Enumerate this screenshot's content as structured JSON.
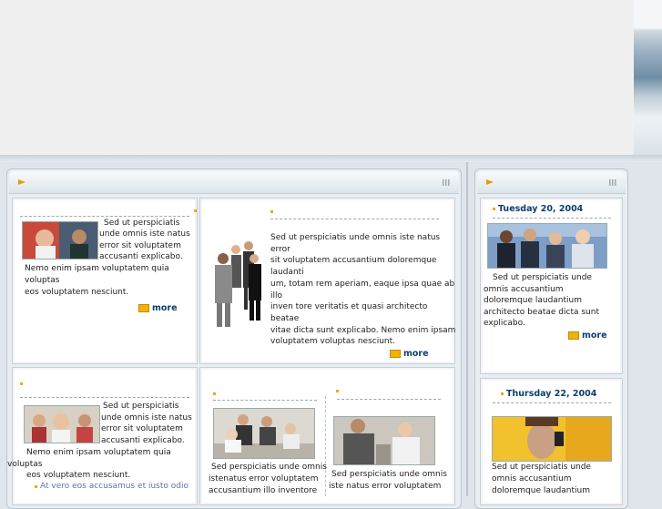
{
  "colors": {
    "accent": "#f0a800",
    "link_dark": "#0e3e6e",
    "link_light": "#5577aa",
    "panel_bg": "#e9eef2"
  },
  "icons": [
    "arrow-right-icon",
    "grip-icon",
    "bullet-icon",
    "more-icon"
  ],
  "articles": {
    "a1": {
      "lines": [
        "Sed ut perspiciatis",
        "unde  omnis iste natus",
        "error sit  voluptatem",
        "accusanti  explicabo.",
        "Nemo enim ipsam voluptatem quia",
        "voluptas",
        "eos voluptatem nesciunt."
      ],
      "more": "more"
    },
    "a2": {
      "lines": [
        "Sed ut perspiciatis unde omnis iste natus",
        "error",
        "sit voluptatem accusantium doloremque",
        "laudanti",
        "um, totam rem aperiam, eaque ipsa quae ab",
        "illo",
        "inven tore veritatis et quasi architecto",
        "beatae",
        "vitae dicta sunt explicabo. Nemo enim ipsam",
        "voluptatem voluptas nesciunt."
      ],
      "more": "more"
    },
    "a3": {
      "lines": [
        "Sed ut perspiciatis",
        "unde  omnis iste natus",
        "error sit  voluptatem",
        "accusanti  explicabo.",
        "Nemo enim ipsam voluptatem quia",
        "voluptas",
        "eos voluptatem nesciunt."
      ],
      "link": "At vero eos accusamus et iusto odio"
    },
    "a4": {
      "lines": [
        "Sed perspiciatis unde omnis",
        "istenatus error voluptatem",
        "accusantium illo inventore"
      ]
    },
    "a5": {
      "lines": [
        "Sed perspiciatis unde omnis",
        "iste  natus error voluptatem"
      ]
    }
  },
  "sidebar": {
    "n1": {
      "date": "Tuesday 20, 2004",
      "lines": [
        "Sed ut perspiciatis unde",
        "omnis     accusantium",
        "doloremque    laudantium",
        "architecto beatae     dicta sunt",
        "explicabo."
      ],
      "more": "more"
    },
    "n2": {
      "date": "Thursday 22, 2004",
      "lines": [
        "Sed ut perspiciatis unde",
        "omnis accusantium",
        "doloremque laudantium"
      ]
    }
  }
}
